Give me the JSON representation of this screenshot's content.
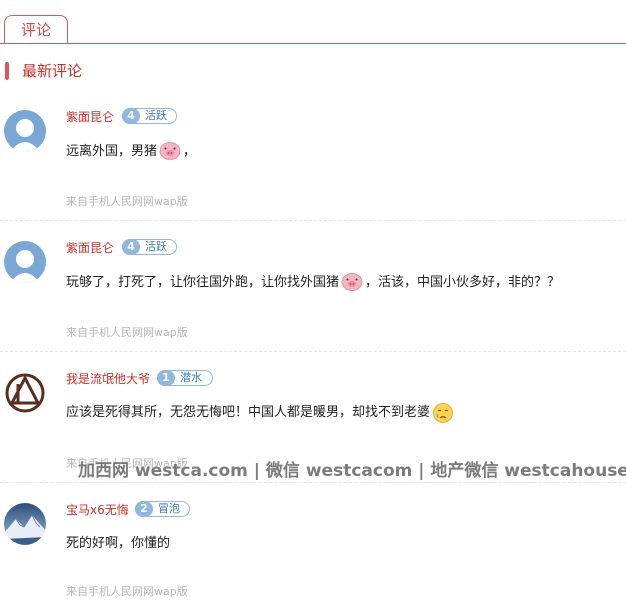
{
  "tabs": [
    {
      "label": "评论"
    }
  ],
  "section_title": "最新评论",
  "watermark": "加西网 westca.com | 微信 westcacom | 地产微信 westcahouse",
  "comments": [
    {
      "username": "紫面昆仑",
      "level": "4",
      "level_label": "活跃",
      "text_before": "远离外国，男猪",
      "emoji": "pig-face-icon",
      "text_after": "，",
      "source": "来自手机人民网网wap版"
    },
    {
      "username": "紫面昆仑",
      "level": "4",
      "level_label": "活跃",
      "text_before": "玩够了，打死了，让你往国外跑，让你找外国猪",
      "emoji": "pig-face-icon",
      "text_after": "，活该，中国小伙多好，非的？？",
      "source": "来自手机人民网网wap版"
    },
    {
      "username": "我是流氓他大爷",
      "level": "1",
      "level_label": "潜水",
      "text_before": "应该是死得其所，无怨无悔吧！中国人都是暖男，却找不到老婆",
      "emoji": "crying-face-icon",
      "text_after": "",
      "source": "来自手机人民网网wap版"
    },
    {
      "username": "宝马x6无悔",
      "level": "2",
      "level_label": "冒泡",
      "text_before": "死的好啊，你懂的",
      "emoji": "",
      "text_after": "",
      "source": "来自手机人民网网wap版"
    }
  ]
}
